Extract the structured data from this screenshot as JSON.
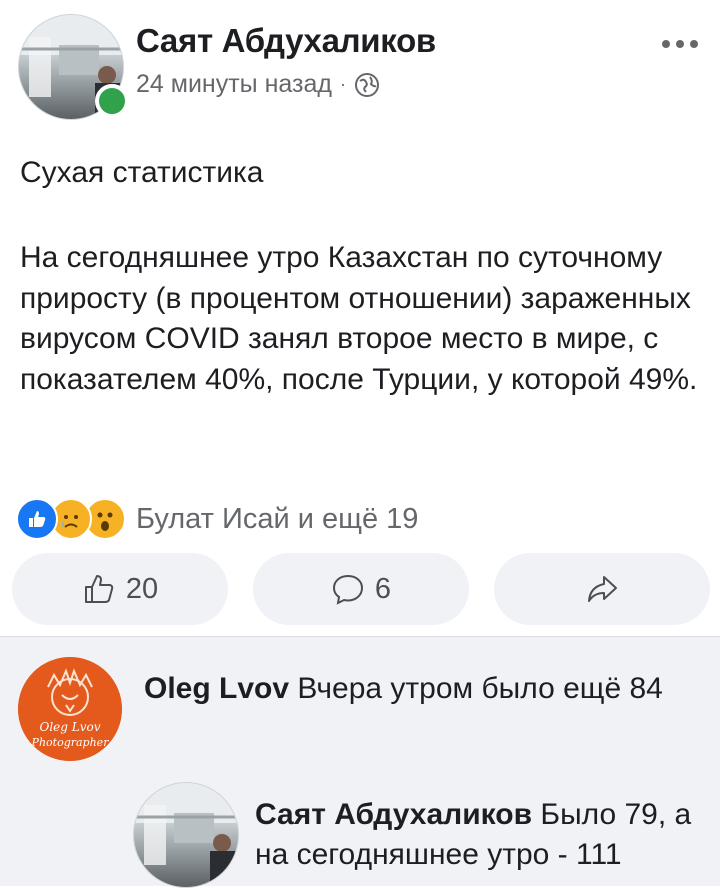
{
  "post": {
    "author": "Саят Абдухаликов",
    "time": "24 минуты назад",
    "separator": "·",
    "privacy_icon": "globe-icon",
    "title": "Сухая статистика",
    "body": "На сегодняшнее утро Казахстан по суточному приросту (в процентом отношении) зараженных вирусом COVID занял второе место в мире, с показателем  40%, после Турции, у которой 49%.",
    "reactions": {
      "icons": [
        "like-icon",
        "sad-icon",
        "wow-icon"
      ],
      "summary": "Булат Исай и ещё 19"
    },
    "actions": {
      "like_count": "20",
      "comment_count": "6"
    }
  },
  "comments": [
    {
      "author": "Oleg Lvov",
      "text": "Вчера утром было ещё 84",
      "avatar_text_line1": "Oleg Lvov",
      "avatar_text_line2": "Photographer"
    },
    {
      "author": "Саят Абдухаликов",
      "text": "Было 79, а на сегодняшнее утро - 111"
    }
  ],
  "colors": {
    "accent": "#1877f2",
    "online": "#31a24c",
    "secondary_text": "#65676b",
    "comments_bg": "#f0f2f5"
  }
}
